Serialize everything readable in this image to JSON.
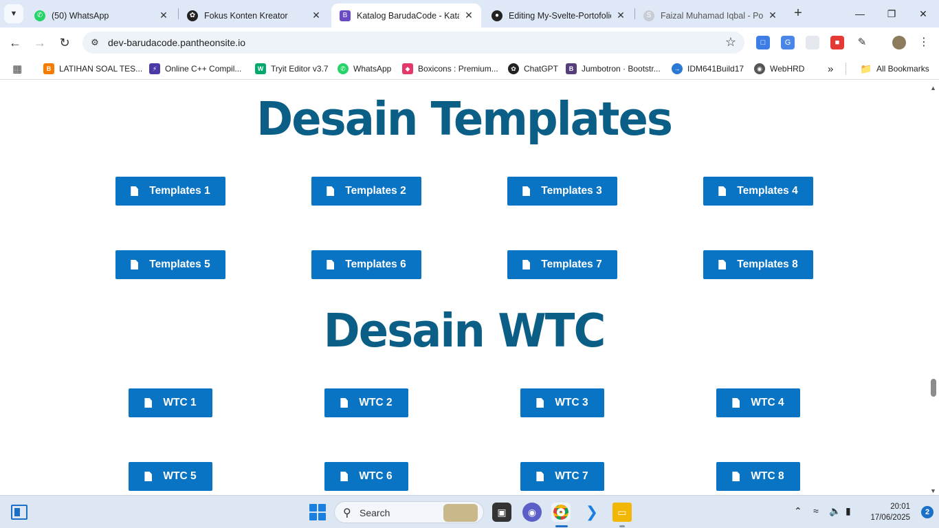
{
  "browser": {
    "tabs": [
      {
        "title": "(50) WhatsApp",
        "icon": "whatsapp-icon"
      },
      {
        "title": "Fokus Konten Kreator",
        "icon": "chatgpt-icon"
      },
      {
        "title": "Katalog BarudaCode - Katalo",
        "icon": "barudacode-icon"
      },
      {
        "title": "Editing My-Svelte-Portofolio",
        "icon": "github-icon"
      },
      {
        "title": "Faizal Muhamad Iqbal - Port",
        "icon": "svelte-icon"
      }
    ],
    "address": "dev-barudacode.pantheonsite.io",
    "bookmarks": [
      {
        "label": "LATIHAN SOAL TES...",
        "icon": "blogger-icon",
        "color": "#f57c00"
      },
      {
        "label": "Online C++ Compil...",
        "icon": "bolt-icon",
        "color": "#4a3aa8"
      },
      {
        "label": "Tryit Editor v3.7",
        "icon": "w3schools-icon",
        "color": "#04aa6d"
      },
      {
        "label": "WhatsApp",
        "icon": "whatsapp-icon",
        "color": "#25d366"
      },
      {
        "label": "Boxicons : Premium...",
        "icon": "boxicons-icon",
        "color": "#e3386a"
      },
      {
        "label": "ChatGPT",
        "icon": "chatgpt-icon",
        "color": "#222222"
      },
      {
        "label": "Jumbotron · Bootstr...",
        "icon": "bootstrap-icon",
        "color": "#563d7c"
      },
      {
        "label": "IDM641Build17",
        "icon": "idm-icon",
        "color": "#2a79d3"
      },
      {
        "label": "WebHRD",
        "icon": "globe-icon",
        "color": "#555555"
      }
    ],
    "all_bookmarks": "All Bookmarks"
  },
  "page": {
    "sections": [
      {
        "title": "Desain Templates",
        "buttons": [
          "Templates 1",
          "Templates 2",
          "Templates 3",
          "Templates 4",
          "Templates 5",
          "Templates 6",
          "Templates 7",
          "Templates 8"
        ]
      },
      {
        "title": "Desain WTC",
        "buttons": [
          "WTC 1",
          "WTC 2",
          "WTC 3",
          "WTC 4",
          "WTC 5",
          "WTC 6",
          "WTC 7",
          "WTC 8"
        ]
      }
    ]
  },
  "taskbar": {
    "search_placeholder": "Search",
    "time": "20:01",
    "date": "17/06/2025",
    "notifications": "2"
  },
  "colors": {
    "accent": "#0a74c4",
    "heading": "#0b5e86"
  }
}
